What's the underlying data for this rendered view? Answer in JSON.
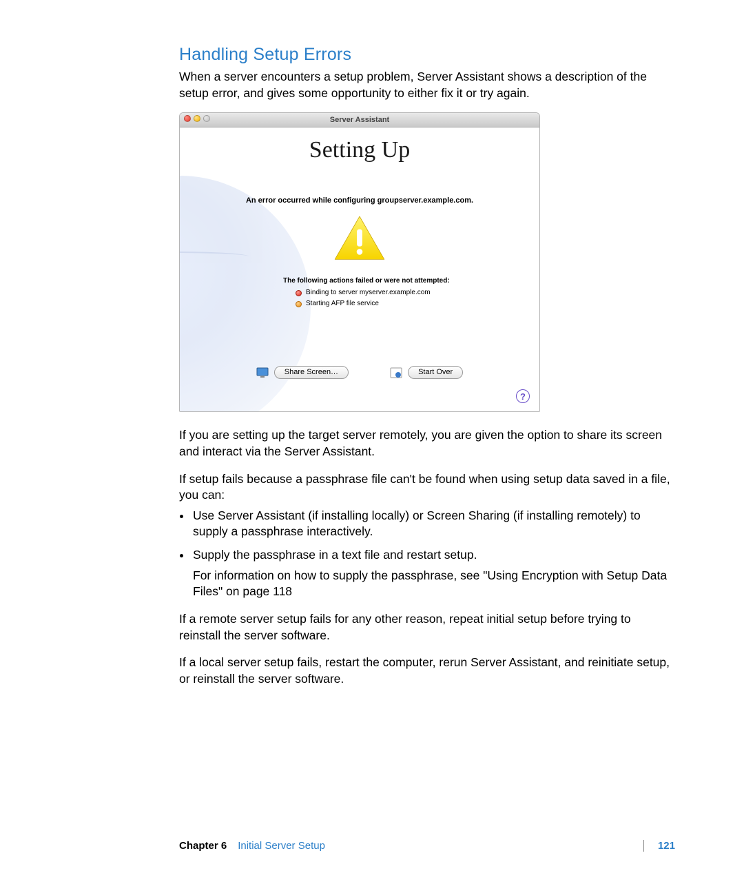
{
  "section": {
    "title": "Handling Setup Errors",
    "intro": "When a server encounters a setup problem, Server Assistant shows a description of the setup error, and gives some opportunity to either fix it or try again."
  },
  "window": {
    "titlebar": "Server Assistant",
    "heading": "Setting Up",
    "error": "An error occurred while configuring groupserver.example.com.",
    "actions_label": "The following actions failed or were not attempted:",
    "actions": {
      "a0": "Binding to server myserver.example.com",
      "a1": "Starting AFP file service"
    },
    "btn_share": "Share Screen…",
    "btn_start_over": "Start Over",
    "help": "?"
  },
  "body": {
    "p1": "If you are setting up the target server remotely, you are given the option to share its screen and interact via the Server Assistant.",
    "p2": "If setup fails because a passphrase file can't be found when using setup data saved in a file, you can:",
    "b1": "Use Server Assistant (if installing locally) or Screen Sharing (if installing remotely) to supply a passphrase interactively.",
    "b2": "Supply the passphrase in a text file and restart setup.",
    "b2sub": "For information on how to supply the passphrase, see \"Using Encryption with Setup Data Files\" on page 118",
    "p3": "If a remote server setup fails for any other reason, repeat initial setup before trying to reinstall the server software.",
    "p4": "If a local server setup fails, restart the computer, rerun Server Assistant, and reinitiate setup, or reinstall the server software."
  },
  "footer": {
    "chapter_label": "Chapter 6",
    "chapter_title": "Initial Server Setup",
    "page": "121"
  }
}
